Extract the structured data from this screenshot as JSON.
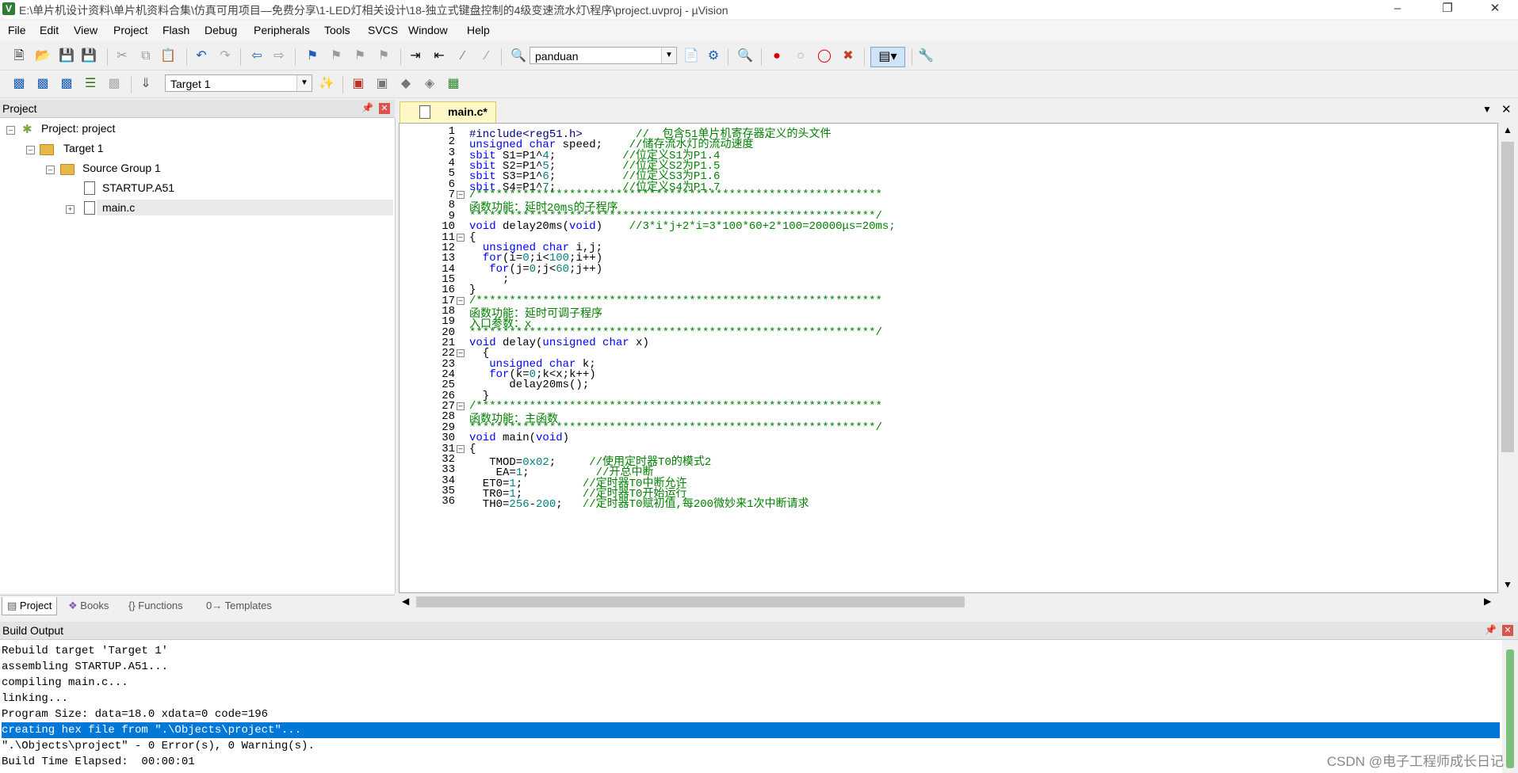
{
  "window": {
    "title": "E:\\单片机设计资料\\单片机资料合集\\仿真可用项目—免费分享\\1-LED灯相关设计\\18-独立式键盘控制的4级变速流水灯\\程序\\project.uvproj - µVision",
    "app_icon": "V"
  },
  "menu": [
    "File",
    "Edit",
    "View",
    "Project",
    "Flash",
    "Debug",
    "Peripherals",
    "Tools",
    "SVCS",
    "Window",
    "Help"
  ],
  "toolbar1": {
    "find_combo": "panduan"
  },
  "toolbar2": {
    "target_combo": "Target 1"
  },
  "project_panel": {
    "title": "Project",
    "tree": [
      {
        "label": "Project: project"
      },
      {
        "label": "Target 1"
      },
      {
        "label": "Source Group 1"
      },
      {
        "label": "STARTUP.A51"
      },
      {
        "label": "main.c"
      }
    ],
    "tabs": [
      "Project",
      "Books",
      "{} Functions",
      "0→ Templates"
    ]
  },
  "editor": {
    "tab_label": "main.c*",
    "lines": [
      "1",
      "2",
      "3",
      "4",
      "5",
      "6",
      "7",
      "8",
      "9",
      "10",
      "11",
      "12",
      "13",
      "14",
      "15",
      "16",
      "17",
      "18",
      "19",
      "20",
      "21",
      "22",
      "23",
      "24",
      "25",
      "26",
      "27",
      "28",
      "29",
      "30",
      "31",
      "32",
      "33",
      "34",
      "35",
      "36"
    ],
    "code": [
      "#include<reg51.h>        //  包含51单片机寄存器定义的头文件",
      "unsigned char speed;    //储存流水灯的流动速度",
      "sbit S1=P1^4;          //位定义S1为P1.4",
      "sbit S2=P1^5;          //位定义S2为P1.5",
      "sbit S3=P1^6;          //位定义S3为P1.6",
      "sbit S4=P1^7;          //位定义S4为P1.7",
      "/*************************************************************",
      "函数功能：延时20ms的子程序",
      "*************************************************************/",
      "void delay20ms(void)    //3*i*j+2*i=3*100*60+2*100=20000μs=20ms;",
      "{",
      "  unsigned char i,j;",
      "  for(i=0;i<100;i++)",
      "   for(j=0;j<60;j++)",
      "     ;",
      "}",
      "/*************************************************************",
      "函数功能：延时可调子程序",
      "入口参数：x",
      "*************************************************************/",
      "void delay(unsigned char x)",
      "  {",
      "   unsigned char k;",
      "   for(k=0;k<x;k++)",
      "      delay20ms();",
      "  }",
      "/*************************************************************",
      "函数功能：主函数",
      "*************************************************************/",
      "void main(void)",
      "{",
      "   TMOD=0x02;     //使用定时器T0的模式2",
      "    EA=1;          //开总中断",
      "  ET0=1;         //定时器T0中断允许",
      "  TR0=1;         //定时器T0开始运行",
      "  TH0=256-200;   //定时器T0赋初值,每200微妙来1次中断请求"
    ]
  },
  "build_output": {
    "title": "Build Output",
    "lines": [
      "Rebuild target 'Target 1'",
      "assembling STARTUP.A51...",
      "compiling main.c...",
      "linking...",
      "Program Size: data=18.0 xdata=0 code=196",
      "creating hex file from \".\\Objects\\project\"...",
      "\".\\Objects\\project\" - 0 Error(s), 0 Warning(s).",
      "Build Time Elapsed:  00:00:01"
    ],
    "selected_index": 5
  },
  "watermark": "CSDN @电子工程师成长日记"
}
